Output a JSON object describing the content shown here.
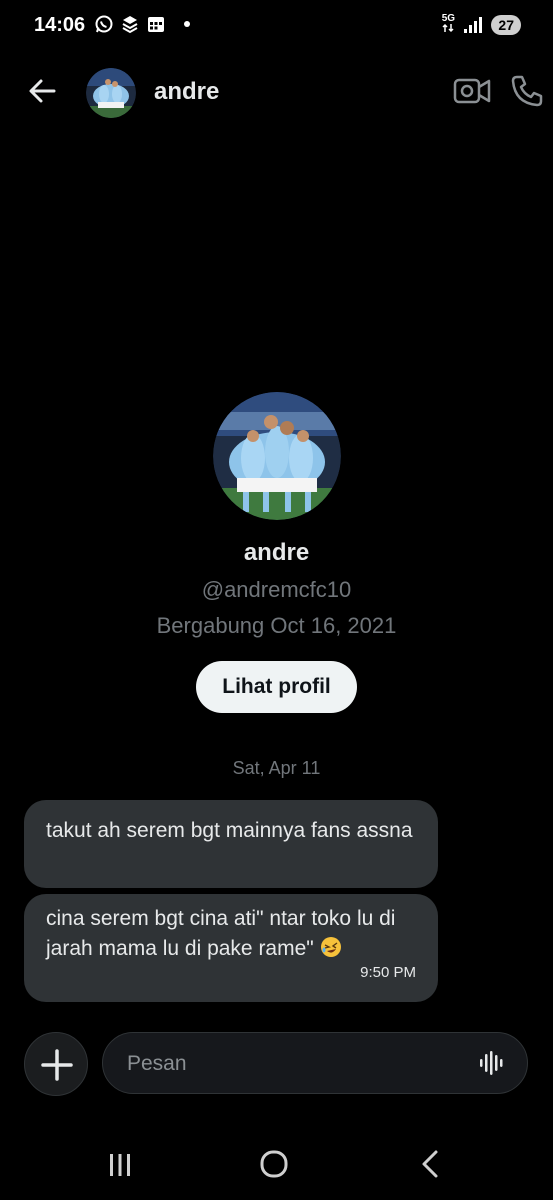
{
  "status_bar": {
    "time": "14:06",
    "network": "5G",
    "battery": "27"
  },
  "header": {
    "name": "andre"
  },
  "profile": {
    "name": "andre",
    "handle": "@andremcfc10",
    "joined": "Bergabung Oct 16, 2021",
    "view_profile_label": "Lihat profil"
  },
  "conversation": {
    "date": "Sat, Apr 11",
    "messages": [
      {
        "text": "takut ah serem bgt mainnya fans assna"
      },
      {
        "text": "cina serem bgt cina ati\" ntar toko lu di jarah mama lu di pake rame\" ",
        "emoji": "rolling-on-floor-laughing",
        "time": "9:50 PM"
      }
    ]
  },
  "composer": {
    "placeholder": "Pesan"
  },
  "colors": {
    "background": "#000000",
    "bubble": "#2f3336",
    "muted_text": "#71767b",
    "button_bg": "#eff3f4"
  }
}
